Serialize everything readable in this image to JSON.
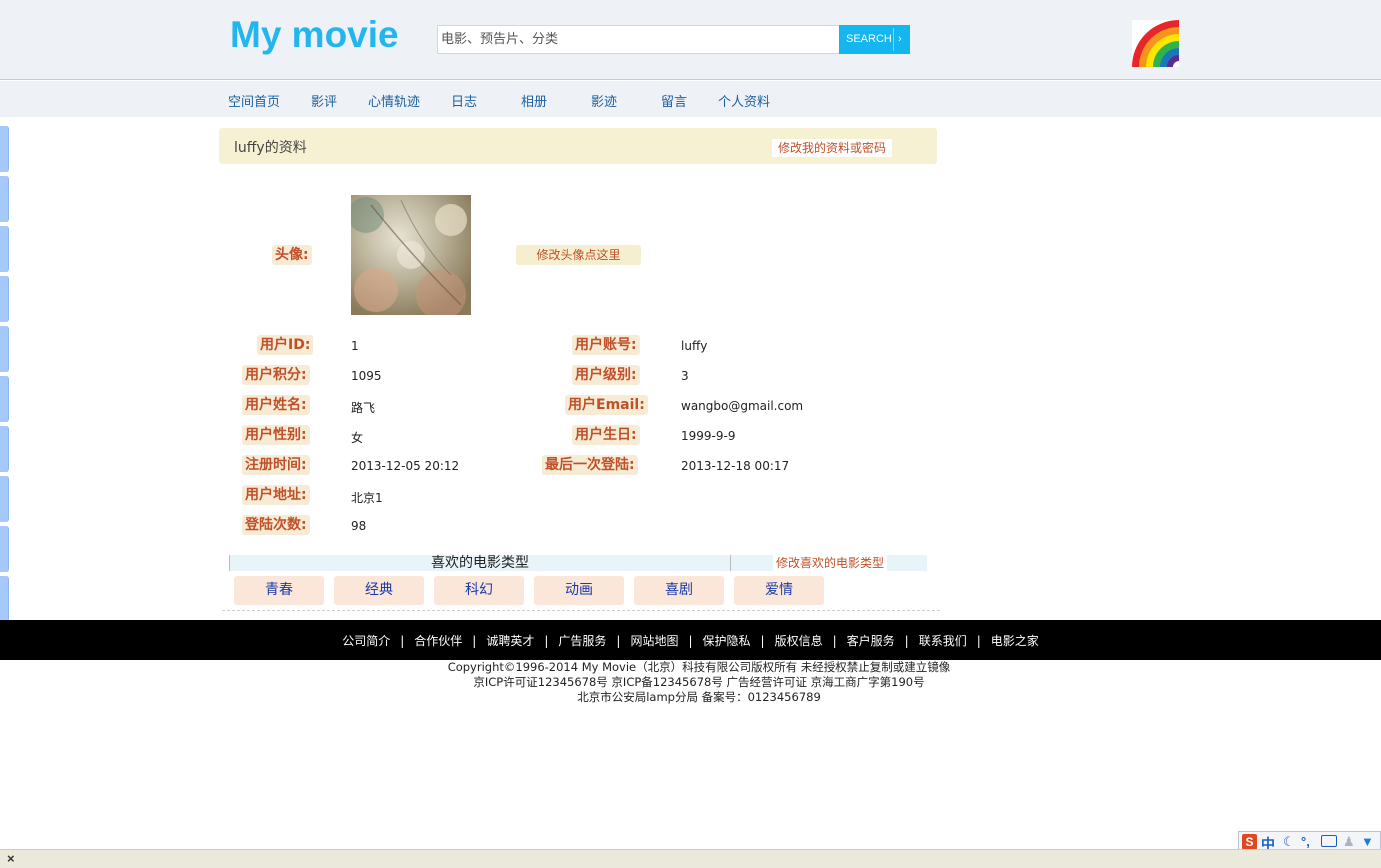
{
  "header": {
    "logo": "My movie",
    "search_placeholder": "电影、预告片、分类",
    "search_button": "SEARCH",
    "search_arrow": "›"
  },
  "nav": [
    "空间首页",
    "影评",
    "心情轨迹",
    "日志",
    "相册",
    "影迹",
    "留言",
    "个人资料"
  ],
  "profile": {
    "title": "luffy的资料",
    "edit_link": "修改我的资料或密码",
    "avatar_label": "头像:",
    "edit_avatar": "修改头像点这里",
    "fields_left": [
      {
        "label": "用户ID:",
        "value": "1"
      },
      {
        "label": "用户积分:",
        "value": "1095"
      },
      {
        "label": "用户姓名:",
        "value": "路飞"
      },
      {
        "label": "用户性别:",
        "value": "女"
      },
      {
        "label": "注册时间:",
        "value": "2013-12-05 20:12"
      },
      {
        "label": "用户地址:",
        "value": "北京1"
      },
      {
        "label": "登陆次数:",
        "value": "98"
      }
    ],
    "fields_right": [
      {
        "label": "用户账号:",
        "value": "luffy"
      },
      {
        "label": "用户级别:",
        "value": "3"
      },
      {
        "label": "用户Email:",
        "value": "wangbo@gmail.com"
      },
      {
        "label": "用户生日:",
        "value": "1999-9-9"
      },
      {
        "label": "最后一次登陆:",
        "value": "2013-12-18 00:17"
      }
    ]
  },
  "genres": {
    "title": "喜欢的电影类型",
    "edit_link": "修改喜欢的电影类型",
    "items": [
      "青春",
      "经典",
      "科幻",
      "动画",
      "喜剧",
      "爱情"
    ]
  },
  "footer": {
    "links": [
      "公司简介",
      "合作伙伴",
      "诚聘英才",
      "广告服务",
      "网站地图",
      "保护隐私",
      "版权信息",
      "客户服务",
      "联系我们",
      "电影之家"
    ],
    "copyright_lines": [
      "Copyright©1996-2014 My Movie（北京）科技有限公司版权所有 未经授权禁止复制或建立镜像",
      "京ICP许可证12345678号 京ICP备12345678号   广告经营许可证 京海工商广字第190号",
      "北京市公安局lamp分局 备案号：0123456789"
    ]
  },
  "system": {
    "close": "×",
    "ime_chinese": "中"
  },
  "colors": {
    "accent": "#13b6ef",
    "label_text": "#c0502a",
    "label_bg": "#f6ecd6",
    "chip_bg": "#fbe6da",
    "chip_text": "#1a3aa8"
  }
}
